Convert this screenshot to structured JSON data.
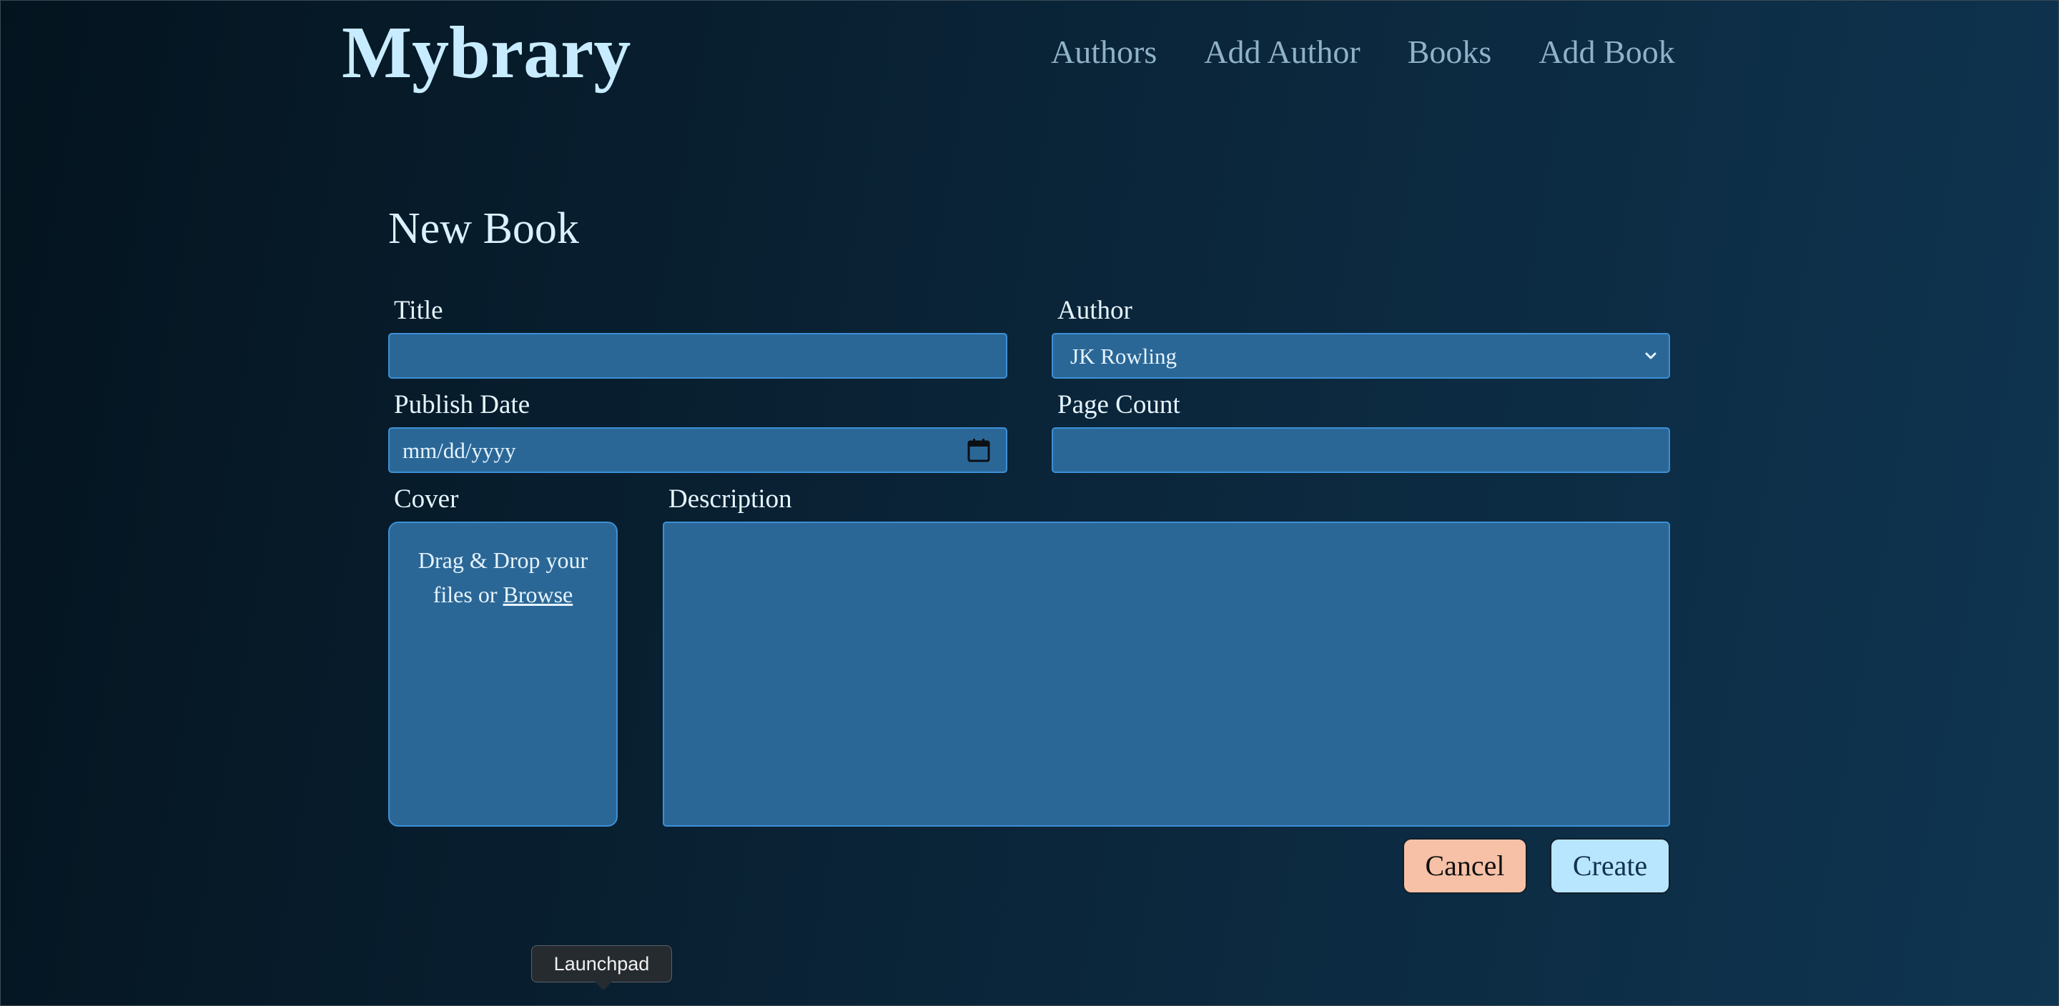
{
  "header": {
    "logo": "Mybrary",
    "nav": [
      "Authors",
      "Add Author",
      "Books",
      "Add Book"
    ]
  },
  "page": {
    "title": "New Book"
  },
  "form": {
    "title_label": "Title",
    "title_value": "",
    "author_label": "Author",
    "author_selected": "JK Rowling",
    "publish_date_label": "Publish Date",
    "publish_date_placeholder": "mm/dd/yyyy",
    "page_count_label": "Page Count",
    "page_count_value": "",
    "cover_label": "Cover",
    "cover_drop_text": "Drag & Drop your files or",
    "cover_browse": "Browse",
    "description_label": "Description",
    "description_value": "",
    "cancel_label": "Cancel",
    "create_label": "Create"
  },
  "dock_tooltip": {
    "label": "Launchpad"
  },
  "colors": {
    "field_bg": "#2b6796",
    "field_border": "#3d8fd6",
    "cancel_bg": "#f6c1a6",
    "create_bg": "#b9e6ff",
    "logo": "#c8ecff"
  }
}
